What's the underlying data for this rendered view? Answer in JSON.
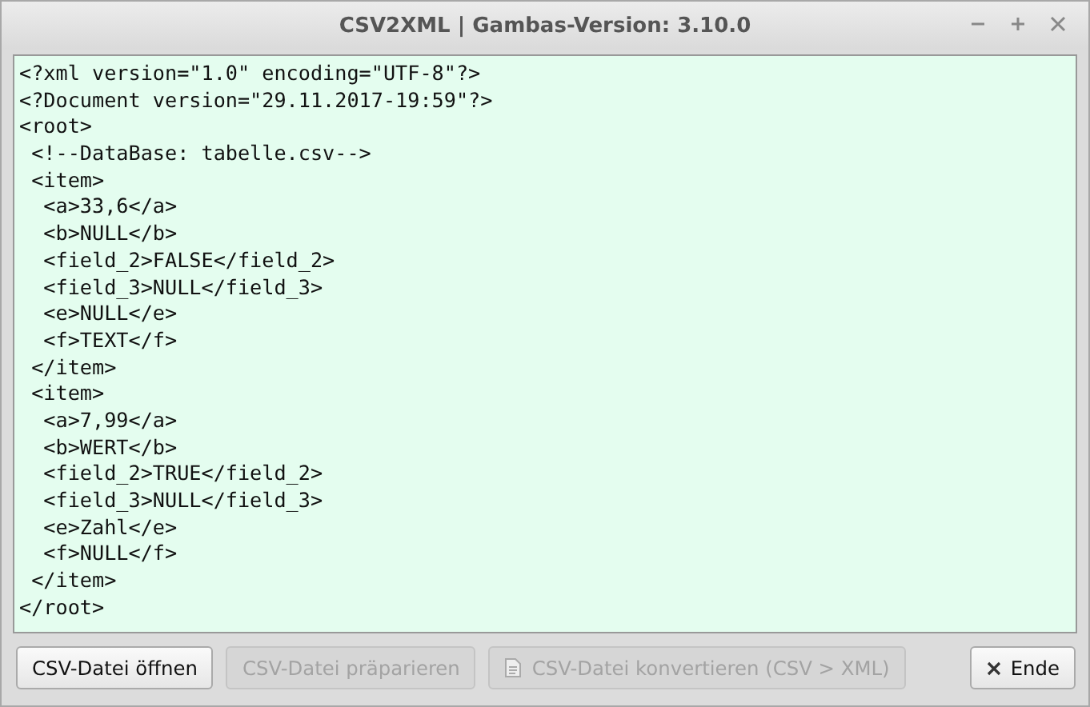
{
  "window": {
    "title": "CSV2XML | Gambas-Version: 3.10.0"
  },
  "editor": {
    "lines": [
      "<?xml version=\"1.0\" encoding=\"UTF-8\"?>",
      "<?Document version=\"29.11.2017-19:59\"?>",
      "<root>",
      " <!--DataBase: tabelle.csv-->",
      " <item>",
      "  <a>33,6</a>",
      "  <b>NULL</b>",
      "  <field_2>FALSE</field_2>",
      "  <field_3>NULL</field_3>",
      "  <e>NULL</e>",
      "  <f>TEXT</f>",
      " </item>",
      " <item>",
      "  <a>7,99</a>",
      "  <b>WERT</b>",
      "  <field_2>TRUE</field_2>",
      "  <field_3>NULL</field_3>",
      "  <e>Zahl</e>",
      "  <f>NULL</f>",
      " </item>",
      "</root>"
    ]
  },
  "buttons": [
    {
      "label": "CSV-Datei öffnen",
      "disabled": false,
      "kind": "plain"
    },
    {
      "label": "CSV-Datei präparieren",
      "disabled": true,
      "kind": "plain"
    },
    {
      "label": "CSV-Datei konvertieren (CSV > XML)",
      "disabled": true,
      "kind": "convert"
    },
    {
      "label": "Ende",
      "disabled": false,
      "kind": "quit"
    }
  ]
}
